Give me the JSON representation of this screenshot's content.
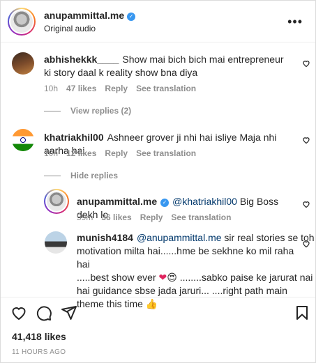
{
  "post": {
    "username": "anupammittal.me",
    "audio": "Original audio"
  },
  "comments": [
    {
      "username": "abhishekkk____",
      "text": "Show mai bich bich mai entrepreneur ki story daal k reality show bna diya",
      "time": "10h",
      "likes": "47 likes",
      "reply": "Reply",
      "translate": "See translation",
      "replies_toggle": "View replies (2)"
    },
    {
      "username": "khatriakhil00",
      "text": "Ashneer grover ji nhi hai isliye Maja nhi aarha hai",
      "time": "10h",
      "likes": "12 likes",
      "reply": "Reply",
      "translate": "See translation",
      "replies_toggle": "Hide replies",
      "replies": [
        {
          "username": "anupammittal.me",
          "mention": "@khatriakhil00",
          "text": "Big Boss dekh lo",
          "time": "59m",
          "likes": "36 likes",
          "reply": "Reply",
          "translate": "See translation"
        }
      ]
    },
    {
      "username": "munish4184",
      "mention": "@anupammittal.me",
      "line1": "sir real stories se toh",
      "line2": "motivation milta hai......hme be sekhne ko mil raha hai",
      "line3": ".....best show ever",
      "line3b": "........sabko paise ke jarurat nai",
      "line4": "hai guidance sbse jada jaruri... ....right path main",
      "line5": "theme this time",
      "emoji_heart": "❤",
      "emoji_love": "😍",
      "emoji_thumb": "👍"
    }
  ],
  "footer": {
    "likes": "41,418 likes",
    "time": "11 HOURS AGO"
  },
  "icons": {
    "more": "•••",
    "verified": "✓"
  },
  "colors": {
    "verified": "#3897f0",
    "mention": "#00376b",
    "secondary": "#8e8e8e"
  }
}
